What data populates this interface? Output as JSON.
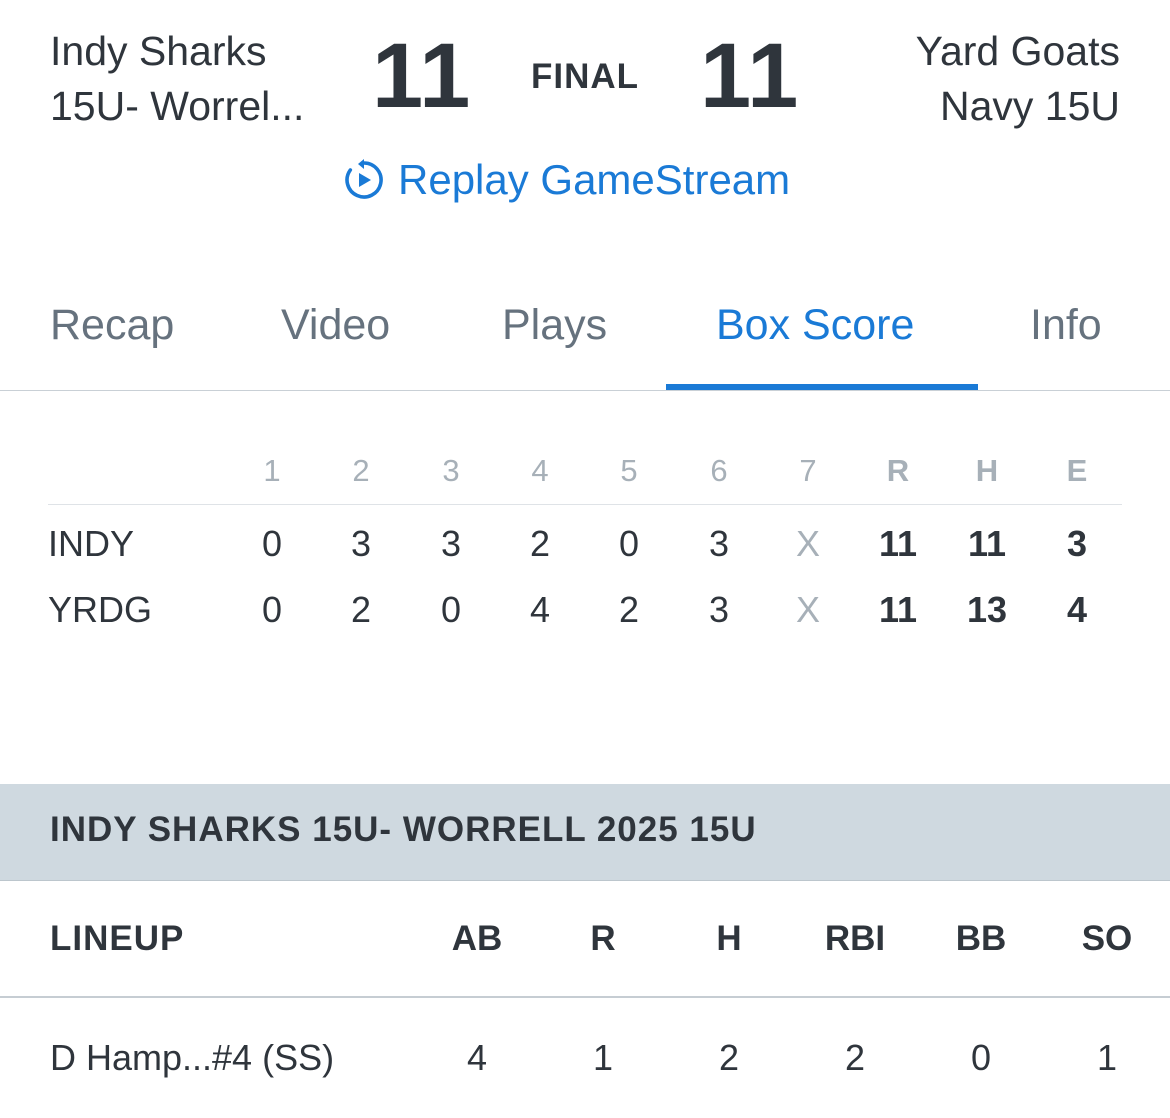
{
  "game": {
    "home_team_line1": "Indy Sharks",
    "home_team_line2": "15U- Worrel...",
    "home_score": "11",
    "status": "FINAL",
    "away_score": "11",
    "away_team_line1": "Yard Goats",
    "away_team_line2": "Navy 15U",
    "replay_label": "Replay GameStream",
    "replay_icon": "replay-play-icon"
  },
  "tabs": [
    {
      "label": "Recap"
    },
    {
      "label": "Video"
    },
    {
      "label": "Plays"
    },
    {
      "label": "Box Score",
      "active": true
    },
    {
      "label": "Info"
    }
  ],
  "linescore": {
    "headers": [
      "1",
      "2",
      "3",
      "4",
      "5",
      "6",
      "7",
      "R",
      "H",
      "E"
    ],
    "rows": [
      {
        "team": "INDY",
        "innings": [
          "0",
          "3",
          "3",
          "2",
          "0",
          "3",
          "X"
        ],
        "r": "11",
        "h": "11",
        "e": "3"
      },
      {
        "team": "YRDG",
        "innings": [
          "0",
          "2",
          "0",
          "4",
          "2",
          "3",
          "X"
        ],
        "r": "11",
        "h": "13",
        "e": "4"
      }
    ]
  },
  "team_section": {
    "title": "INDY SHARKS 15U- WORRELL 2025 15U"
  },
  "batting": {
    "headers": {
      "lineup": "LINEUP",
      "ab": "AB",
      "r": "R",
      "h": "H",
      "rbi": "RBI",
      "bb": "BB",
      "so": "SO"
    },
    "rows": [
      {
        "player": "D Hamp...#4 (SS)",
        "ab": "4",
        "r": "1",
        "h": "2",
        "rbi": "2",
        "bb": "0",
        "so": "1"
      }
    ]
  },
  "colors": {
    "accent": "#1a7ad6",
    "text": "#2f353c",
    "muted": "#66727e",
    "banner": "#cfd9e0"
  }
}
